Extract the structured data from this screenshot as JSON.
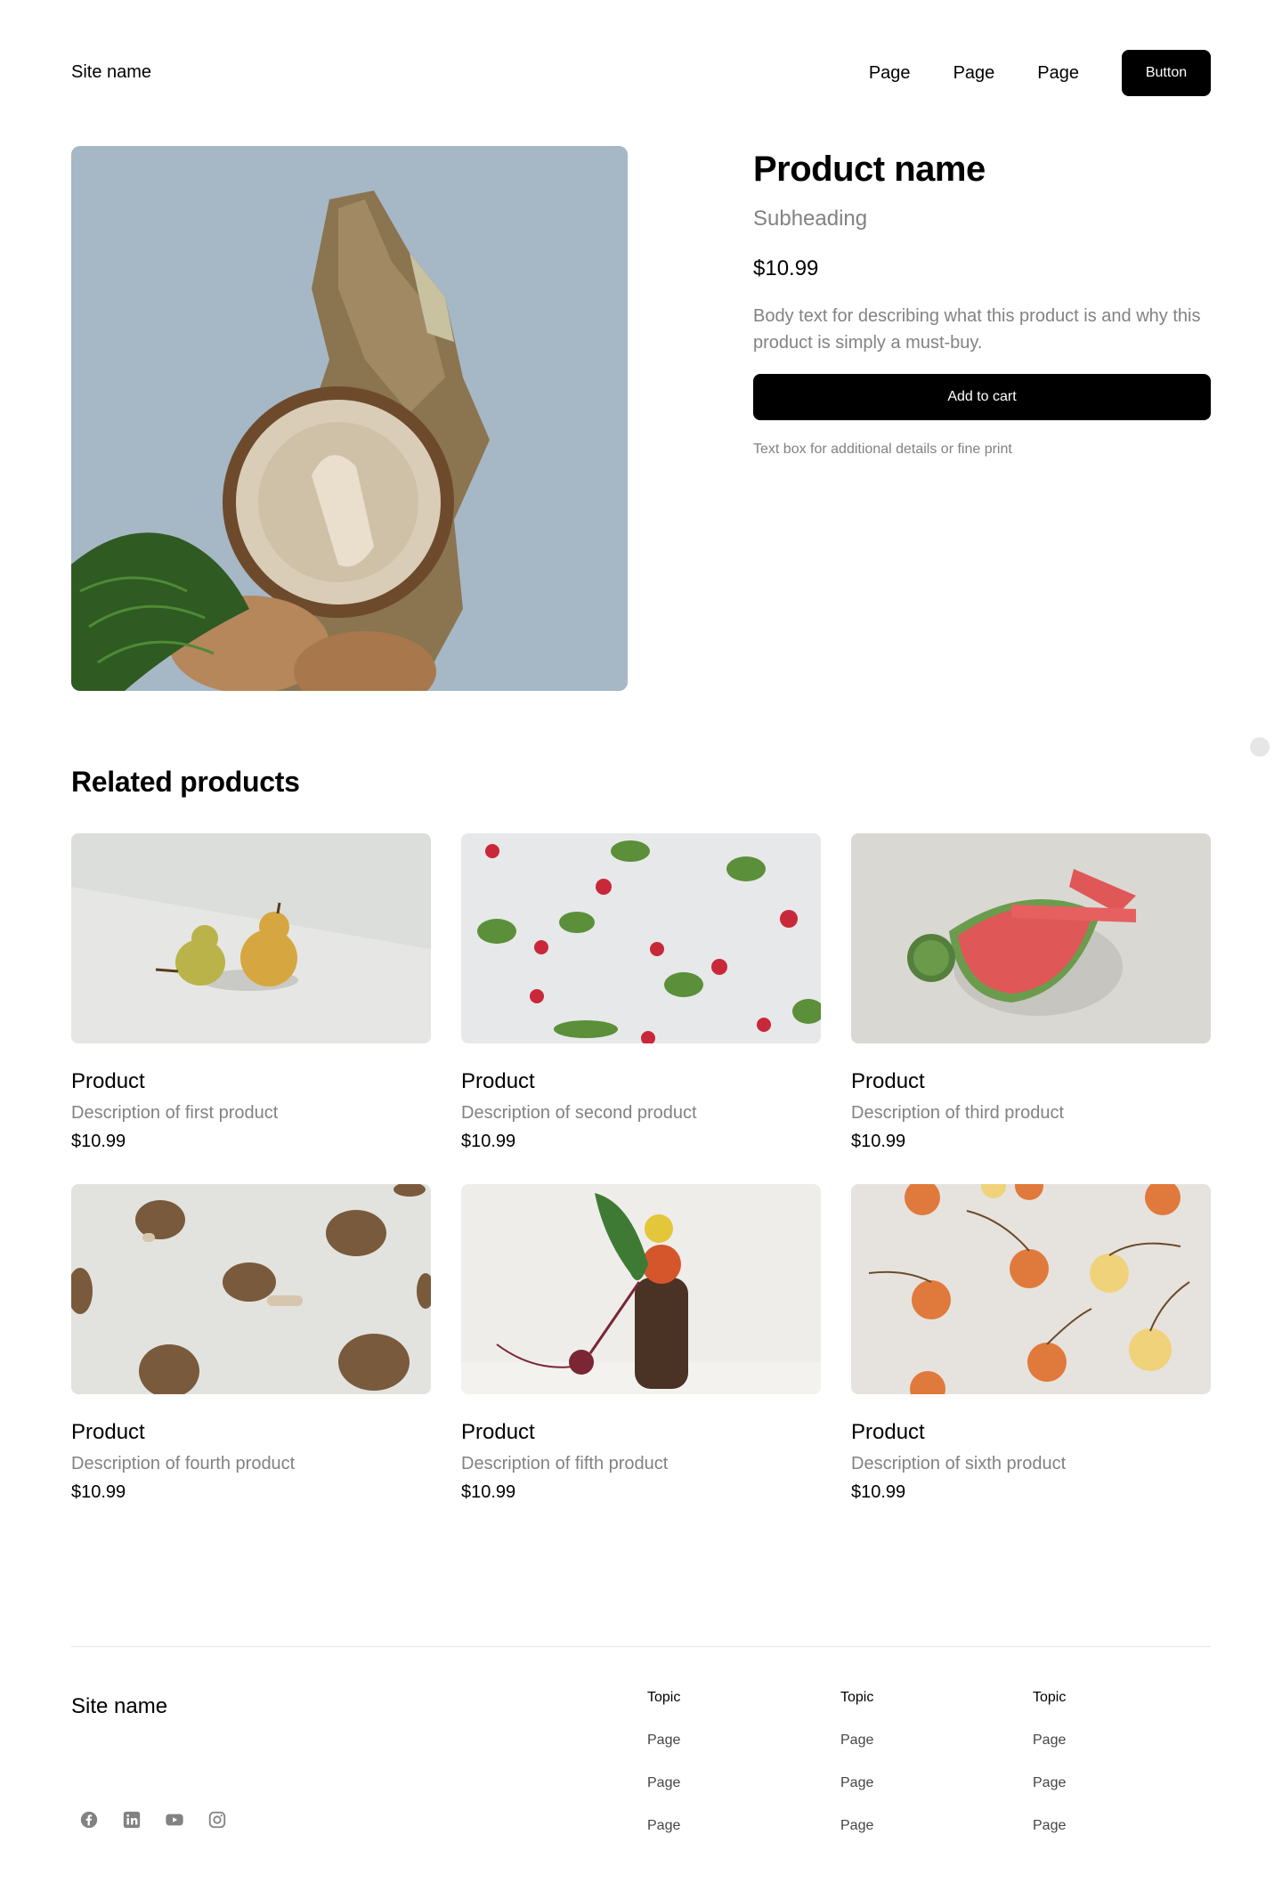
{
  "header": {
    "site_name": "Site name",
    "nav": [
      "Page",
      "Page",
      "Page"
    ],
    "button_label": "Button"
  },
  "product": {
    "title": "Product name",
    "subheading": "Subheading",
    "price": "$10.99",
    "body": "Body text for describing what this product is and why this product is simply a must-buy.",
    "cart_label": "Add to cart",
    "fine_print": "Text box for additional details or fine print"
  },
  "related": {
    "title": "Related products",
    "items": [
      {
        "name": "Product",
        "description": "Description of first product",
        "price": "$10.99",
        "image": "pears"
      },
      {
        "name": "Product",
        "description": "Description of second product",
        "price": "$10.99",
        "image": "radishes"
      },
      {
        "name": "Product",
        "description": "Description of third product",
        "price": "$10.99",
        "image": "watermelon"
      },
      {
        "name": "Product",
        "description": "Description of fourth product",
        "price": "$10.99",
        "image": "mushrooms"
      },
      {
        "name": "Product",
        "description": "Description of fifth product",
        "price": "$10.99",
        "image": "beet-stack"
      },
      {
        "name": "Product",
        "description": "Description of sixth product",
        "price": "$10.99",
        "image": "cherries"
      }
    ]
  },
  "footer": {
    "site_name": "Site name",
    "columns": [
      {
        "title": "Topic",
        "links": [
          "Page",
          "Page",
          "Page"
        ]
      },
      {
        "title": "Topic",
        "links": [
          "Page",
          "Page",
          "Page"
        ]
      },
      {
        "title": "Topic",
        "links": [
          "Page",
          "Page",
          "Page"
        ]
      }
    ],
    "socials": [
      "facebook-icon",
      "linkedin-icon",
      "youtube-icon",
      "instagram-icon"
    ]
  },
  "colors": {
    "primary": "#000000",
    "muted_text": "#828282",
    "footer_link": "#454545",
    "divider": "#e6e6e6"
  }
}
